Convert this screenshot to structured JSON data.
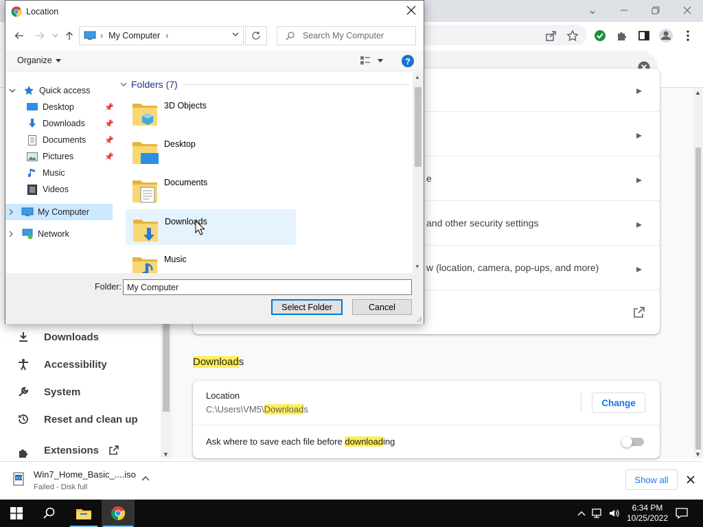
{
  "dialog": {
    "title": "Location",
    "address": "My Computer",
    "search_placeholder": "Search My Computer",
    "organize_label": "Organize",
    "help_label": "?",
    "folders_header": "Folders (7)",
    "tree": {
      "quick_access": "Quick access",
      "items": [
        "Desktop",
        "Downloads",
        "Documents",
        "Pictures",
        "Music",
        "Videos"
      ],
      "my_computer": "My Computer",
      "network": "Network"
    },
    "folders": [
      "3D Objects",
      "Desktop",
      "Documents",
      "Downloads",
      "Music"
    ],
    "folder_label": "Folder:",
    "folder_value": "My Computer",
    "select_button": "Select Folder",
    "cancel_button": "Cancel"
  },
  "settings": {
    "privacy_rows": [
      {
        "text": ""
      },
      {
        "text": ""
      },
      {
        "text": "e"
      },
      {
        "text": " and other security settings"
      },
      {
        "text": "w (location, camera, pop-ups, and more)"
      }
    ],
    "nav": {
      "downloads": "Downloads",
      "accessibility": "Accessibility",
      "system": "System",
      "reset": "Reset and clean up",
      "extensions": "Extensions"
    },
    "downloads_section": {
      "heading_hl": "Download",
      "heading_rest": "s",
      "location_label": "Location",
      "location_path_prefix": "C:\\Users\\VM5\\",
      "location_path_hl": "Download",
      "location_path_suffix": "s",
      "change_button": "Change",
      "ask_prefix": "Ask where to save each file before ",
      "ask_hl": "download",
      "ask_suffix": "ing",
      "ask_toggle_on": false
    }
  },
  "shelf": {
    "filename": "Win7_Home_Basic_....iso",
    "status": "Failed - Disk full",
    "show_all": "Show all"
  },
  "taskbar": {
    "time": "6:34 PM",
    "date": "10/25/2022"
  },
  "colors": {
    "accent": "#1a73e8",
    "highlight": "#ffee58",
    "selection": "#cce8ff",
    "hover": "#e5f3ff"
  }
}
